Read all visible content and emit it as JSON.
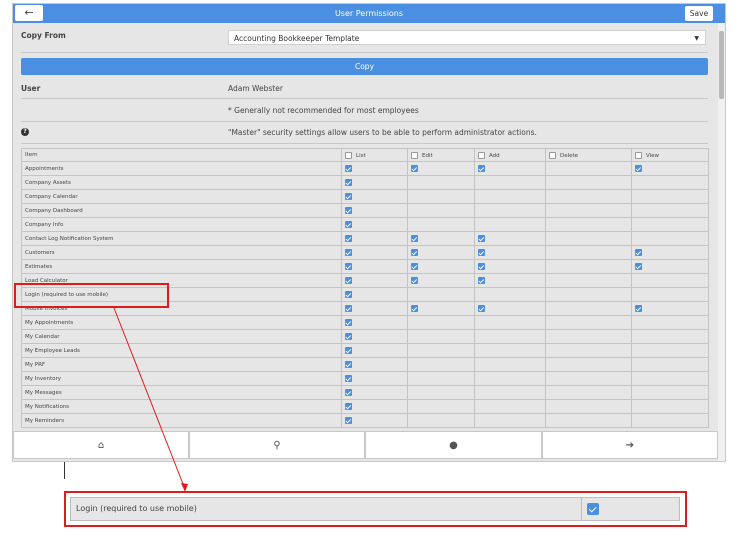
{
  "header": {
    "back_icon": "arrow-left",
    "title": "User Permissions",
    "save_label": "Save"
  },
  "copy_from": {
    "label": "Copy From",
    "selected": "Accounting Bookkeeper Template"
  },
  "copy_button": "Copy",
  "user": {
    "label": "User",
    "value": "Adam Webster"
  },
  "warning_note": "* Generally not recommended for most employees",
  "master_note": "\"Master\" security settings allow users to be able to perform administrator actions.",
  "table": {
    "headers": [
      "Item",
      "List",
      "Edit",
      "Add",
      "Delete",
      "View"
    ],
    "rows": [
      {
        "item": "Appointments",
        "perms": [
          true,
          true,
          true,
          false,
          true
        ]
      },
      {
        "item": "Company Assets",
        "perms": [
          true,
          false,
          false,
          false,
          false
        ]
      },
      {
        "item": "Company Calendar",
        "perms": [
          true,
          false,
          false,
          false,
          false
        ]
      },
      {
        "item": "Company Dashboard",
        "perms": [
          true,
          false,
          false,
          false,
          false
        ]
      },
      {
        "item": "Company Info",
        "perms": [
          true,
          false,
          false,
          false,
          false
        ]
      },
      {
        "item": "Contact Log Notification System",
        "perms": [
          true,
          true,
          true,
          false,
          false
        ]
      },
      {
        "item": "Customers",
        "perms": [
          true,
          true,
          true,
          false,
          true
        ]
      },
      {
        "item": "Estimates",
        "perms": [
          true,
          true,
          true,
          false,
          true
        ]
      },
      {
        "item": "Load Calculator",
        "perms": [
          true,
          true,
          true,
          false,
          false
        ]
      },
      {
        "item": "Login (required to use mobile)",
        "perms": [
          true,
          false,
          false,
          false,
          false
        ]
      },
      {
        "item": "Mobile Invoices",
        "perms": [
          true,
          true,
          true,
          false,
          true
        ]
      },
      {
        "item": "My Appointments",
        "perms": [
          true,
          false,
          false,
          false,
          false
        ]
      },
      {
        "item": "My Calendar",
        "perms": [
          true,
          false,
          false,
          false,
          false
        ]
      },
      {
        "item": "My Employee Leads",
        "perms": [
          true,
          false,
          false,
          false,
          false
        ]
      },
      {
        "item": "My PRF",
        "perms": [
          true,
          false,
          false,
          false,
          false
        ]
      },
      {
        "item": "My Inventory",
        "perms": [
          true,
          false,
          false,
          false,
          false
        ]
      },
      {
        "item": "My Messages",
        "perms": [
          true,
          false,
          false,
          false,
          false
        ]
      },
      {
        "item": "My Notifications",
        "perms": [
          true,
          false,
          false,
          false,
          false
        ]
      },
      {
        "item": "My Reminders",
        "perms": [
          true,
          false,
          false,
          false,
          false
        ]
      }
    ]
  },
  "bottom_nav": [
    "home-icon",
    "search-icon",
    "chat-icon",
    "logout-icon"
  ],
  "zoom_callout": {
    "item": "Login (required to use mobile)",
    "checked": true
  },
  "colors": {
    "accent": "#4a8fe2",
    "highlight": "#e01b1b"
  }
}
